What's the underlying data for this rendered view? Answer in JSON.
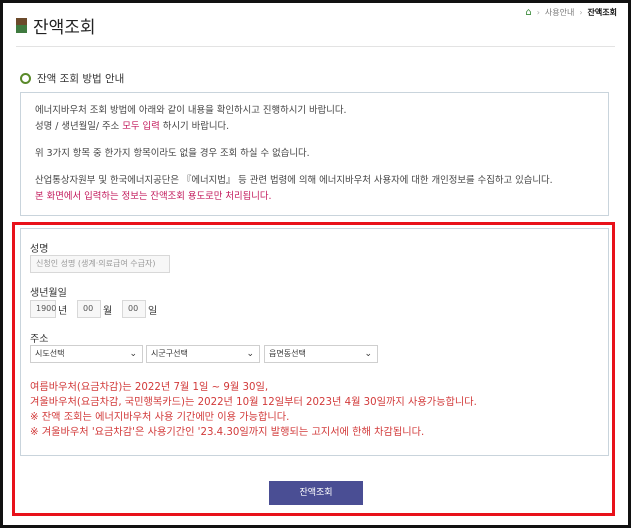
{
  "breadcrumb": {
    "items": [
      "사용안내",
      "잔액조회"
    ]
  },
  "page_title": "잔액조회",
  "section_title": "잔액 조회 방법 안내",
  "info": {
    "line1": "에너지바우처 조회 방법에 아래와 같이 내용을 확인하시고 진행하시기 바랍니다.",
    "line2_prefix": "성명 / 생년월일/ 주소 ",
    "line2_highlight": "모두 입력",
    "line2_suffix": " 하시기 바랍니다.",
    "line3": "위 3가지 항목 중 한가지 항목이라도 없을 경우 조회 하실 수 없습니다.",
    "line4": "산업통상자원부 및 한국에너지공단은 『에너지법』 등 관련 법령에 의해 에너지바우처 사용자에 대한 개인정보를 수집하고 있습니다.",
    "line5": "본 화면에서 입력하는 정보는 잔액조회 용도로만 처리됩니다."
  },
  "form": {
    "name_label": "성명",
    "name_placeholder": "신청인 성명 (생계·의료급여 수급자)",
    "birth_label": "생년월일",
    "year_value": "1900",
    "year_unit": "년",
    "month_value": "00",
    "month_unit": "월",
    "day_value": "00",
    "day_unit": "일",
    "address_label": "주소",
    "sido": "시도선택",
    "sigungu": "시군구선택",
    "eup": "읍면동선택"
  },
  "notice": {
    "line1": "여름바우처(요금차감)는 2022년 7월 1일 ~ 9월 30일,",
    "line2": "겨울바우처(요금차감, 국민행복카드)는 2022년 10월 12일부터 2023년 4월 30일까지 사용가능합니다.",
    "line3": "※ 잔액 조회는 에너지바우처 사용 기간에만 이용 가능합니다.",
    "line4": "※ 겨울바우처 '요금차감'은 사용기간인 '23.4.30일까지 발행되는 고지서에 한해 차감됩니다."
  },
  "submit_label": "잔액조회",
  "colors": {
    "accent_red": "#e8111a",
    "highlight_pink": "#c2185b",
    "button": "#4a4e94",
    "notice_red": "#d23a3a"
  }
}
